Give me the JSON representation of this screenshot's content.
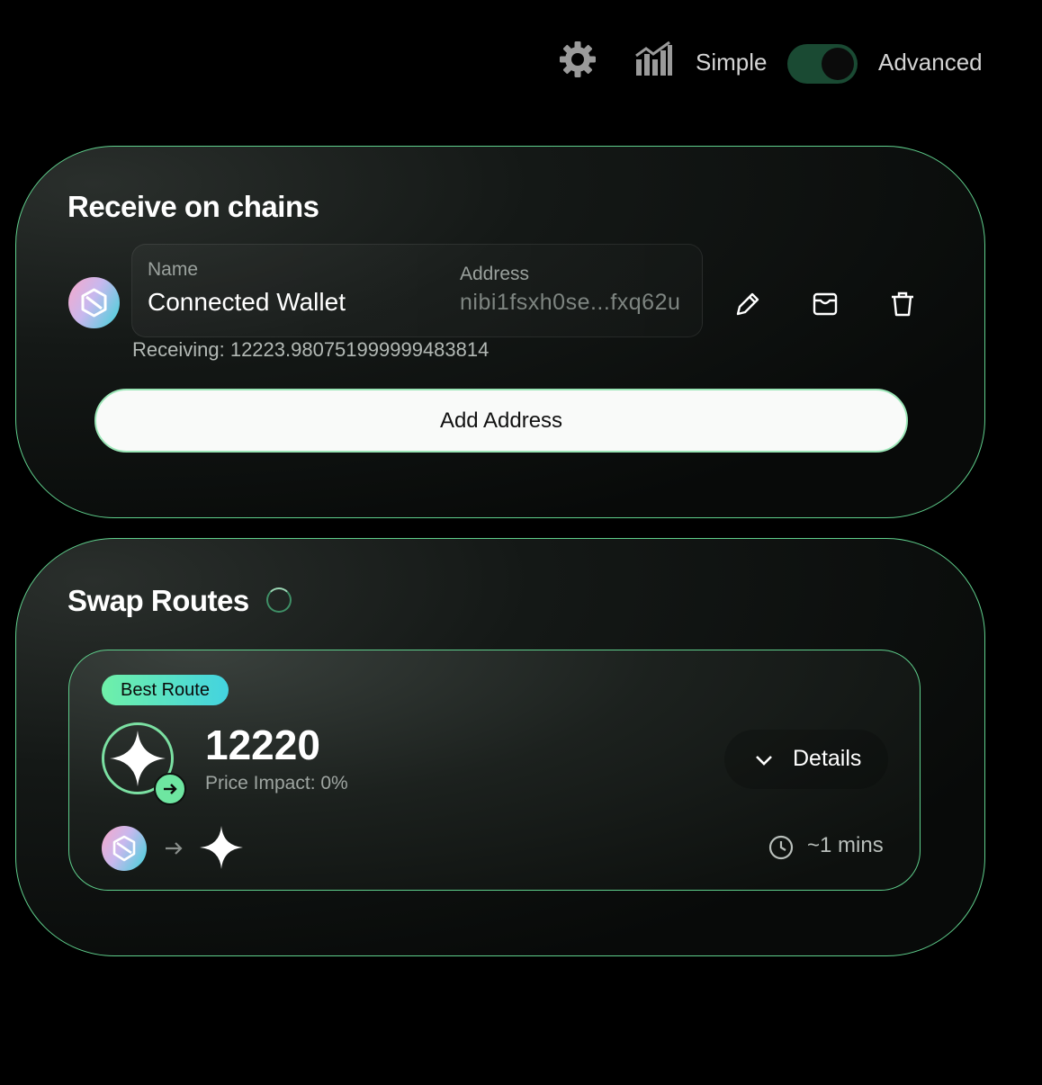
{
  "header": {
    "icons": {
      "settings": "gear-icon",
      "chart": "chart-icon"
    },
    "mode_simple": "Simple",
    "mode_advanced": "Advanced",
    "toggle_on": true
  },
  "receive": {
    "title": "Receive on chains",
    "wallet": {
      "name_label": "Name",
      "name": "Connected Wallet",
      "address_label": "Address",
      "address": "nibi1fsxh0se...fxq62u",
      "receiving": "Receiving: 12223.980751999999483814"
    },
    "add_button": "Add Address"
  },
  "swap": {
    "title": "Swap Routes",
    "route": {
      "badge": "Best Route",
      "amount": "12220",
      "price_impact": "Price Impact: 0%",
      "details_label": "Details",
      "time": "~1 mins"
    }
  },
  "colors": {
    "accent": "#5fcf8c",
    "toggle_track": "#1a4a33",
    "badge_start": "#6ff0a8",
    "badge_end": "#43d3e0"
  }
}
